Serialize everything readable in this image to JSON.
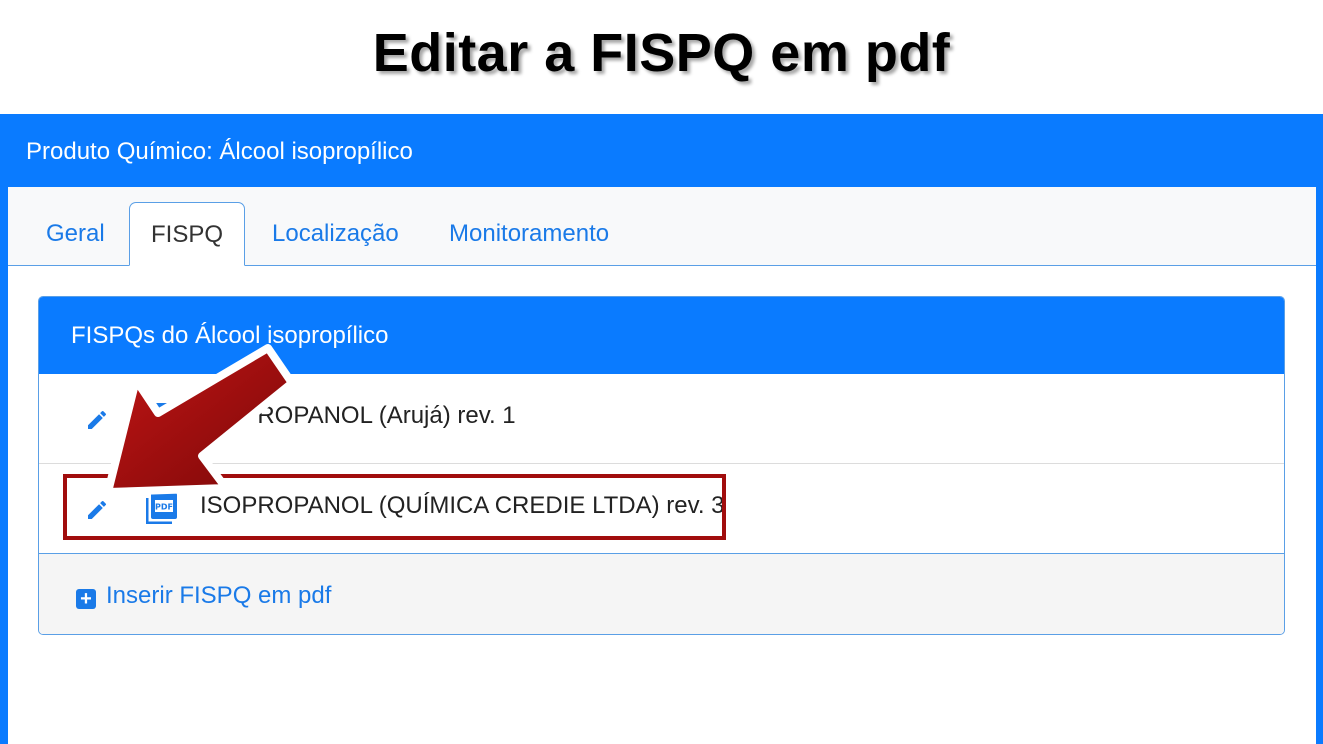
{
  "slide": {
    "title": "Editar a FISPQ em pdf"
  },
  "frame": {
    "header": "Produto Químico: Álcool isopropílico"
  },
  "tabs": [
    {
      "label": "Geral",
      "active": false
    },
    {
      "label": "FISPQ",
      "active": true
    },
    {
      "label": "Localização",
      "active": false
    },
    {
      "label": "Monitoramento",
      "active": false
    }
  ],
  "panel": {
    "title": "FISPQs do Álcool isopropílico",
    "rows": [
      {
        "name": "ISOPROPANOL (Arujá) rev. 1"
      },
      {
        "name": "ISOPROPANOL (QUÍMICA CREDIE LTDA) rev. 3"
      }
    ],
    "add_label": "Inserir FISPQ em pdf"
  },
  "icons": {
    "edit": "pencil-icon",
    "pdf": "pdf-file-icon",
    "add": "plus-square-icon",
    "pdf_badge": "PDF"
  },
  "colors": {
    "brand_blue": "#0a7bff",
    "link_blue": "#1a7ae8",
    "annotation_red": "#a10d0d"
  }
}
